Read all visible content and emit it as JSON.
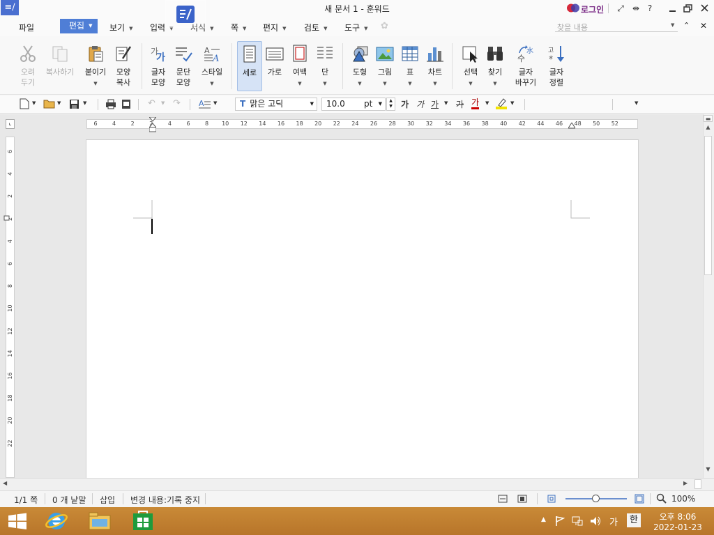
{
  "window": {
    "title": "새 문서 1 - 훈워드",
    "login_label": "로그인",
    "help_label": "?"
  },
  "menu": {
    "file": "파일",
    "edit": "편집",
    "view": "보기",
    "insert": "입력",
    "format": "서식",
    "page": "쪽",
    "mail": "편지",
    "review": "검토",
    "tools": "도구",
    "search_placeholder": "찾을 내용"
  },
  "ribbon": {
    "cut": [
      "오려",
      "두기"
    ],
    "copy": "복사하기",
    "paste": "붙이기",
    "format_copy": [
      "모양",
      "복사"
    ],
    "char_shape": [
      "글자",
      "모양"
    ],
    "para_shape": [
      "문단",
      "모양"
    ],
    "style": "스타일",
    "portrait": "세로",
    "landscape": "가로",
    "margin": "여백",
    "columns": "단",
    "shape": "도형",
    "picture": "그림",
    "table": "표",
    "chart": "차트",
    "select": "선택",
    "find": "찾기",
    "replace": [
      "글자",
      "바꾸기"
    ],
    "sort": [
      "글자",
      "정렬"
    ]
  },
  "format_bar": {
    "font_name": "맑은 고딕",
    "font_size": "10.0",
    "font_unit": "pt",
    "bold": "가",
    "italic": "가",
    "underline": "가",
    "strike": "가",
    "font_color_char": "가"
  },
  "ruler": {
    "h_numbers": [
      "6",
      "4",
      "2",
      "2",
      "4",
      "6",
      "8",
      "10",
      "12",
      "14",
      "16",
      "18",
      "20",
      "22",
      "24",
      "26",
      "28",
      "30",
      "32",
      "34",
      "36",
      "38",
      "40",
      "42",
      "44",
      "46",
      "48",
      "50",
      "52"
    ],
    "v_numbers": [
      "6",
      "4",
      "2",
      "2",
      "4",
      "6",
      "8",
      "10",
      "12",
      "14",
      "16",
      "18",
      "20",
      "22"
    ]
  },
  "status": {
    "page": "1/1 쪽",
    "words": "0 개 낱말",
    "mode": "삽입",
    "track": "변경 내용:기록 중지",
    "zoom": "100%",
    "zoom_level": 0.5
  },
  "taskbar": {
    "ime_ga": "가",
    "ime_han": "한",
    "time": "오후 8:06",
    "date": "2022-01-23"
  },
  "colors": {
    "accent": "#4f7ed6",
    "taskbar": "#c0812f",
    "login": "#7a2b86"
  }
}
